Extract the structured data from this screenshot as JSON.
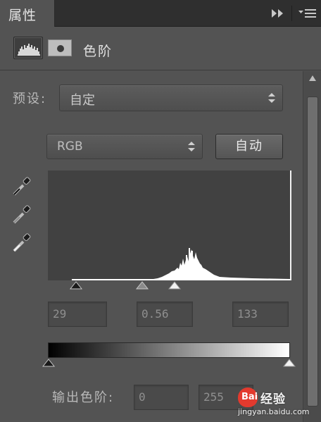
{
  "tab": {
    "label": "属性"
  },
  "header": {
    "title": "色阶",
    "adjustment_icon": "histogram-icon",
    "mask_icon": "mask-icon"
  },
  "preset": {
    "label": "预设:",
    "value": "自定"
  },
  "channel": {
    "value": "RGB"
  },
  "auto_button": {
    "label": "自动"
  },
  "eyedroppers": [
    "black-eyedropper-icon",
    "gray-eyedropper-icon",
    "white-eyedropper-icon"
  ],
  "input_levels": {
    "black": "29",
    "gamma": "0.56",
    "white": "133"
  },
  "output_levels": {
    "label": "输出色阶:",
    "black": "0",
    "white": "255"
  },
  "watermark": {
    "brand": "Bai",
    "text": "经验",
    "url": "jingyan.baidu.com"
  },
  "colors": {
    "panel_bg": "#535353",
    "tab_bar": "#2f2f2f",
    "histogram_bg": "#414141",
    "histogram_fill": "#ffffff"
  }
}
